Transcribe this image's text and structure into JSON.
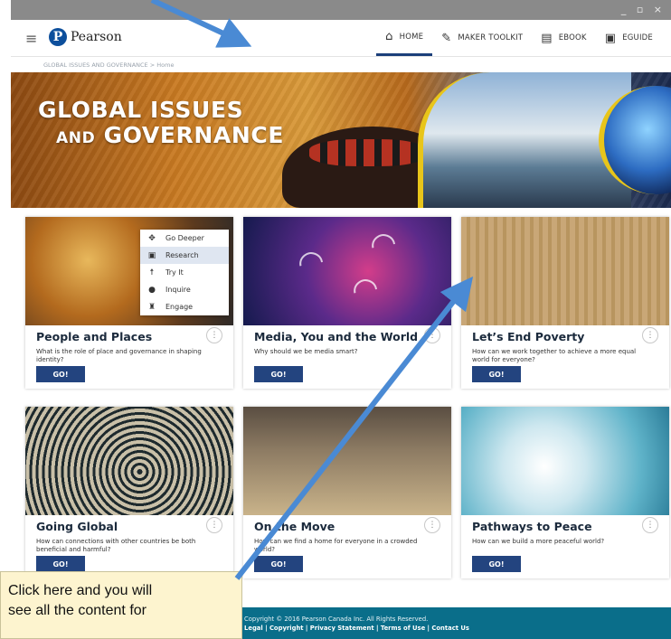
{
  "header": {
    "brand": "Pearson",
    "logo_letter": "P",
    "nav": [
      {
        "label": "HOME",
        "icon": "home-icon",
        "active": true
      },
      {
        "label": "MAKER TOOLKIT",
        "icon": "wrench-icon"
      },
      {
        "label": "EBOOK",
        "icon": "book-icon"
      },
      {
        "label": "EGUIDE",
        "icon": "guide-icon"
      }
    ]
  },
  "breadcrumb": "GLOBAL ISSUES AND GOVERNANCE  >  Home",
  "hero": {
    "line1": "GLOBAL ISSUES",
    "line2_small": "AND",
    "line2_big": "GOVERNANCE"
  },
  "cards": [
    {
      "title": "People and Places",
      "question": "What is the role of place and governance in shaping identity?",
      "button": "GO!"
    },
    {
      "title": "Media, You and the World",
      "question": "Why should we be media smart?",
      "button": "GO!"
    },
    {
      "title": "Let’s End Poverty",
      "question": "How can we work together to achieve a more equal world for everyone?",
      "button": "GO!"
    },
    {
      "title": "Going Global",
      "question": "How can connections with other countries be both beneficial and harmful?",
      "button": "GO!"
    },
    {
      "title": "On the Move",
      "question": "How can we find a home for everyone in a crowded world?",
      "button": "GO!"
    },
    {
      "title": "Pathways to Peace",
      "question": "How can we build a more peaceful world?",
      "button": "GO!"
    }
  ],
  "menu": [
    {
      "label": "Go Deeper",
      "icon": "move-icon"
    },
    {
      "label": "Research",
      "icon": "research-icon",
      "selected": true
    },
    {
      "label": "Try It",
      "icon": "person-icon"
    },
    {
      "label": "Inquire",
      "icon": "inquire-icon"
    },
    {
      "label": "Engage",
      "icon": "engage-icon"
    }
  ],
  "footer": {
    "copyright": "Copyright © 2016 Pearson Canada Inc. All Rights Reserved.",
    "links": "Legal | Copyright | Privacy Statement | Terms of Use | Contact Us"
  },
  "callout": {
    "line1": "Click here and you will",
    "line2": "see all the content for"
  },
  "colors": {
    "nav_active": "#1c3f7a",
    "go_button": "#23447f",
    "footer": "#0a6e8a",
    "arrow": "#4a8ad4",
    "callout_bg": "#fdf4cf"
  }
}
